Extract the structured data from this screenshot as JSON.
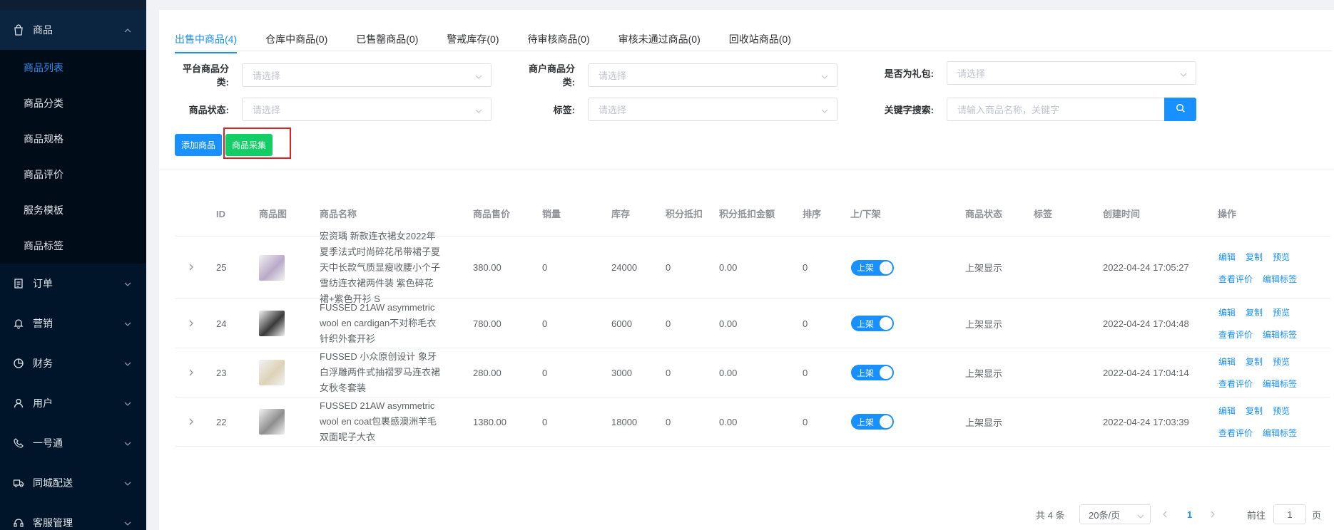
{
  "sidebar": {
    "groups": [
      {
        "label": "商品",
        "icon": "bag-icon"
      },
      {
        "label": "订单",
        "icon": "order-icon"
      },
      {
        "label": "营销",
        "icon": "bell-icon"
      },
      {
        "label": "财务",
        "icon": "pie-icon"
      },
      {
        "label": "用户",
        "icon": "user-icon"
      },
      {
        "label": "一号通",
        "icon": "phone-icon"
      },
      {
        "label": "同城配送",
        "icon": "truck-icon"
      },
      {
        "label": "客服管理",
        "icon": "headset-icon"
      }
    ],
    "sub_items": [
      {
        "label": "商品列表"
      },
      {
        "label": "商品分类"
      },
      {
        "label": "商品规格"
      },
      {
        "label": "商品评价"
      },
      {
        "label": "服务模板"
      },
      {
        "label": "商品标签"
      }
    ]
  },
  "tabs": [
    {
      "label": "出售中商品(4)"
    },
    {
      "label": "仓库中商品(0)"
    },
    {
      "label": "已售罄商品(0)"
    },
    {
      "label": "警戒库存(0)"
    },
    {
      "label": "待审核商品(0)"
    },
    {
      "label": "审核未通过商品(0)"
    },
    {
      "label": "回收站商品(0)"
    }
  ],
  "filters": {
    "platform_category": {
      "label": "平台商品分类:",
      "placeholder": "请选择"
    },
    "merchant_category": {
      "label": "商户商品分类:",
      "placeholder": "请选择"
    },
    "is_gift": {
      "label": "是否为礼包:",
      "placeholder": "请选择"
    },
    "status": {
      "label": "商品状态:",
      "placeholder": "请选择"
    },
    "tag": {
      "label": "标签:",
      "placeholder": "请选择"
    },
    "keyword": {
      "label": "关键字搜索:",
      "placeholder": "请输入商品名称，关键字"
    }
  },
  "buttons": {
    "add": "添加商品",
    "collect": "商品采集"
  },
  "table": {
    "columns": [
      "ID",
      "商品图",
      "商品名称",
      "商品售价",
      "销量",
      "库存",
      "积分抵扣",
      "积分抵扣金额",
      "排序",
      "上/下架",
      "商品状态",
      "标签",
      "创建时间",
      "操作"
    ],
    "rows": [
      {
        "id": "25",
        "name": "宏资瑀 新款连衣裙女2022年夏季法式时尚碎花吊带裙子夏天中长款气质显瘦收腰小个子雪纺连衣裙两件装 紫色碎花裙+紫色开衫 S",
        "price": "380.00",
        "sales": "0",
        "stock": "24000",
        "points": "0",
        "points_amount": "0.00",
        "sort": "0",
        "switch": "上架",
        "status": "上架显示",
        "tag": "",
        "created": "2022-04-24 17:05:27",
        "thumb_color": "#b9a9c8"
      },
      {
        "id": "24",
        "name": "FUSSED 21AW asymmetric wool en cardigan不对称毛衣针织外套开衫",
        "price": "780.00",
        "sales": "0",
        "stock": "6000",
        "points": "0",
        "points_amount": "0.00",
        "sort": "0",
        "switch": "上架",
        "status": "上架显示",
        "tag": "",
        "created": "2022-04-24 17:04:48",
        "thumb_color": "#3a3a3a"
      },
      {
        "id": "23",
        "name": "FUSSED 小众原创设计 象牙白浮雕两件式抽褶罗马连衣裙女秋冬套装",
        "price": "280.00",
        "sales": "0",
        "stock": "3000",
        "points": "0",
        "points_amount": "0.00",
        "sort": "0",
        "switch": "上架",
        "status": "上架显示",
        "tag": "",
        "created": "2022-04-24 17:04:14",
        "thumb_color": "#ddd2b8"
      },
      {
        "id": "22",
        "name": "FUSSED 21AW asymmetric wool en coat包裹感澳洲羊毛双面呢子大衣",
        "price": "1380.00",
        "sales": "0",
        "stock": "18000",
        "points": "0",
        "points_amount": "0.00",
        "sort": "0",
        "switch": "上架",
        "status": "上架显示",
        "tag": "",
        "created": "2022-04-24 17:03:39",
        "thumb_color": "#8e8e8e"
      }
    ],
    "ops": {
      "edit": "编辑",
      "copy": "复制",
      "preview": "预览",
      "view_reviews": "查看评价",
      "edit_tags": "编辑标签"
    }
  },
  "pagination": {
    "total": "共 4 条",
    "page_size": "20条/页",
    "current_page": "1",
    "goto_prefix": "前往",
    "goto_value": "1",
    "goto_suffix": "页"
  },
  "colors": {
    "accent": "#1890ff",
    "success": "#13ce66",
    "sidebar": "#001529",
    "highlight": "#e02020"
  }
}
